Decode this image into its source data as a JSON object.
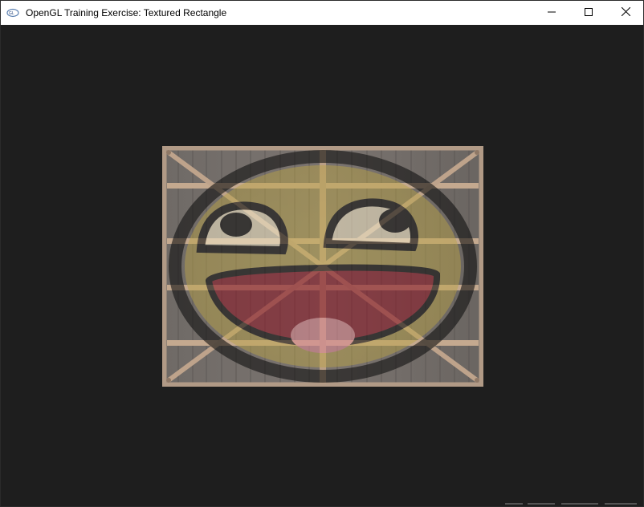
{
  "window": {
    "title": "OpenGL Training Exercise: Textured Rectangle",
    "app_icon": "opengl-logo-icon",
    "controls": {
      "minimize_icon": "minimize-icon",
      "maximize_icon": "maximize-icon",
      "close_icon": "close-icon"
    }
  },
  "scene": {
    "clear_color": "#1e1e1e",
    "textures": [
      "wooden-container-texture",
      "awesome-face-texture"
    ],
    "blend": "mixed overlay"
  }
}
